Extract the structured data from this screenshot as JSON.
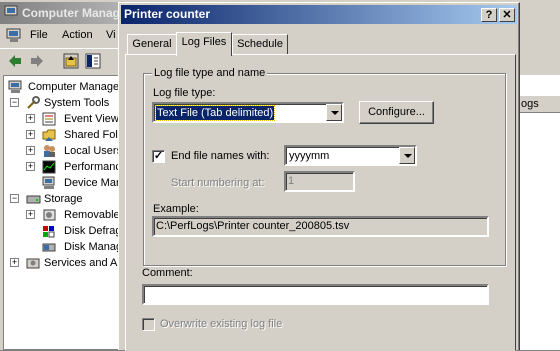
{
  "background_window": {
    "title": "Computer Manag",
    "menu": [
      "File",
      "Action",
      "Vi"
    ],
    "tree": [
      {
        "label": "Computer Manage",
        "icon": "computer-icon",
        "expander": "",
        "indent": 0
      },
      {
        "label": "System Tools",
        "icon": "tools-icon",
        "expander": "−",
        "indent": 1
      },
      {
        "label": "Event Viewe",
        "icon": "event-viewer-icon",
        "expander": "+",
        "indent": 2
      },
      {
        "label": "Shared Fold",
        "icon": "shared-folder-icon",
        "expander": "+",
        "indent": 2
      },
      {
        "label": "Local Users",
        "icon": "users-icon",
        "expander": "+",
        "indent": 2
      },
      {
        "label": "Performanc",
        "icon": "performance-icon",
        "expander": "+",
        "indent": 2
      },
      {
        "label": "Device Mana",
        "icon": "device-manager-icon",
        "expander": "",
        "indent": 2
      },
      {
        "label": "Storage",
        "icon": "storage-icon",
        "expander": "−",
        "indent": 1
      },
      {
        "label": "Removable",
        "icon": "removable-storage-icon",
        "expander": "+",
        "indent": 2
      },
      {
        "label": "Disk Defrag",
        "icon": "defrag-icon",
        "expander": "",
        "indent": 2
      },
      {
        "label": "Disk Manag",
        "icon": "disk-management-icon",
        "expander": "",
        "indent": 2
      },
      {
        "label": "Services and A",
        "icon": "services-icon",
        "expander": "+",
        "indent": 1
      }
    ],
    "right_column_header": "ogs"
  },
  "dialog": {
    "title": "Printer counter",
    "help_button": "?",
    "close_button": "✕",
    "tabs": [
      {
        "label": "General",
        "active": false
      },
      {
        "label": "Log Files",
        "active": true
      },
      {
        "label": "Schedule",
        "active": false
      }
    ],
    "group_title": "Log file type and name",
    "log_file_type_label": "Log file type:",
    "log_file_type_value": "Text File (Tab delimited)",
    "configure_button": "Configure...",
    "end_file_names_label": "End file names with:",
    "end_file_names_checked": true,
    "end_file_names_value": "yyyymm",
    "start_numbering_label": "Start numbering at:",
    "start_numbering_value": "1",
    "example_label": "Example:",
    "example_value": "C:\\PerfLogs\\Printer counter_200805.tsv",
    "comment_label": "Comment:",
    "comment_value": "",
    "overwrite_label": "Overwrite existing log file",
    "overwrite_checked": false
  },
  "colors": {
    "title_active": "#0a246a",
    "title_active_end": "#a6caf0",
    "face": "#d4d0c8",
    "selection": "#0a246a"
  }
}
